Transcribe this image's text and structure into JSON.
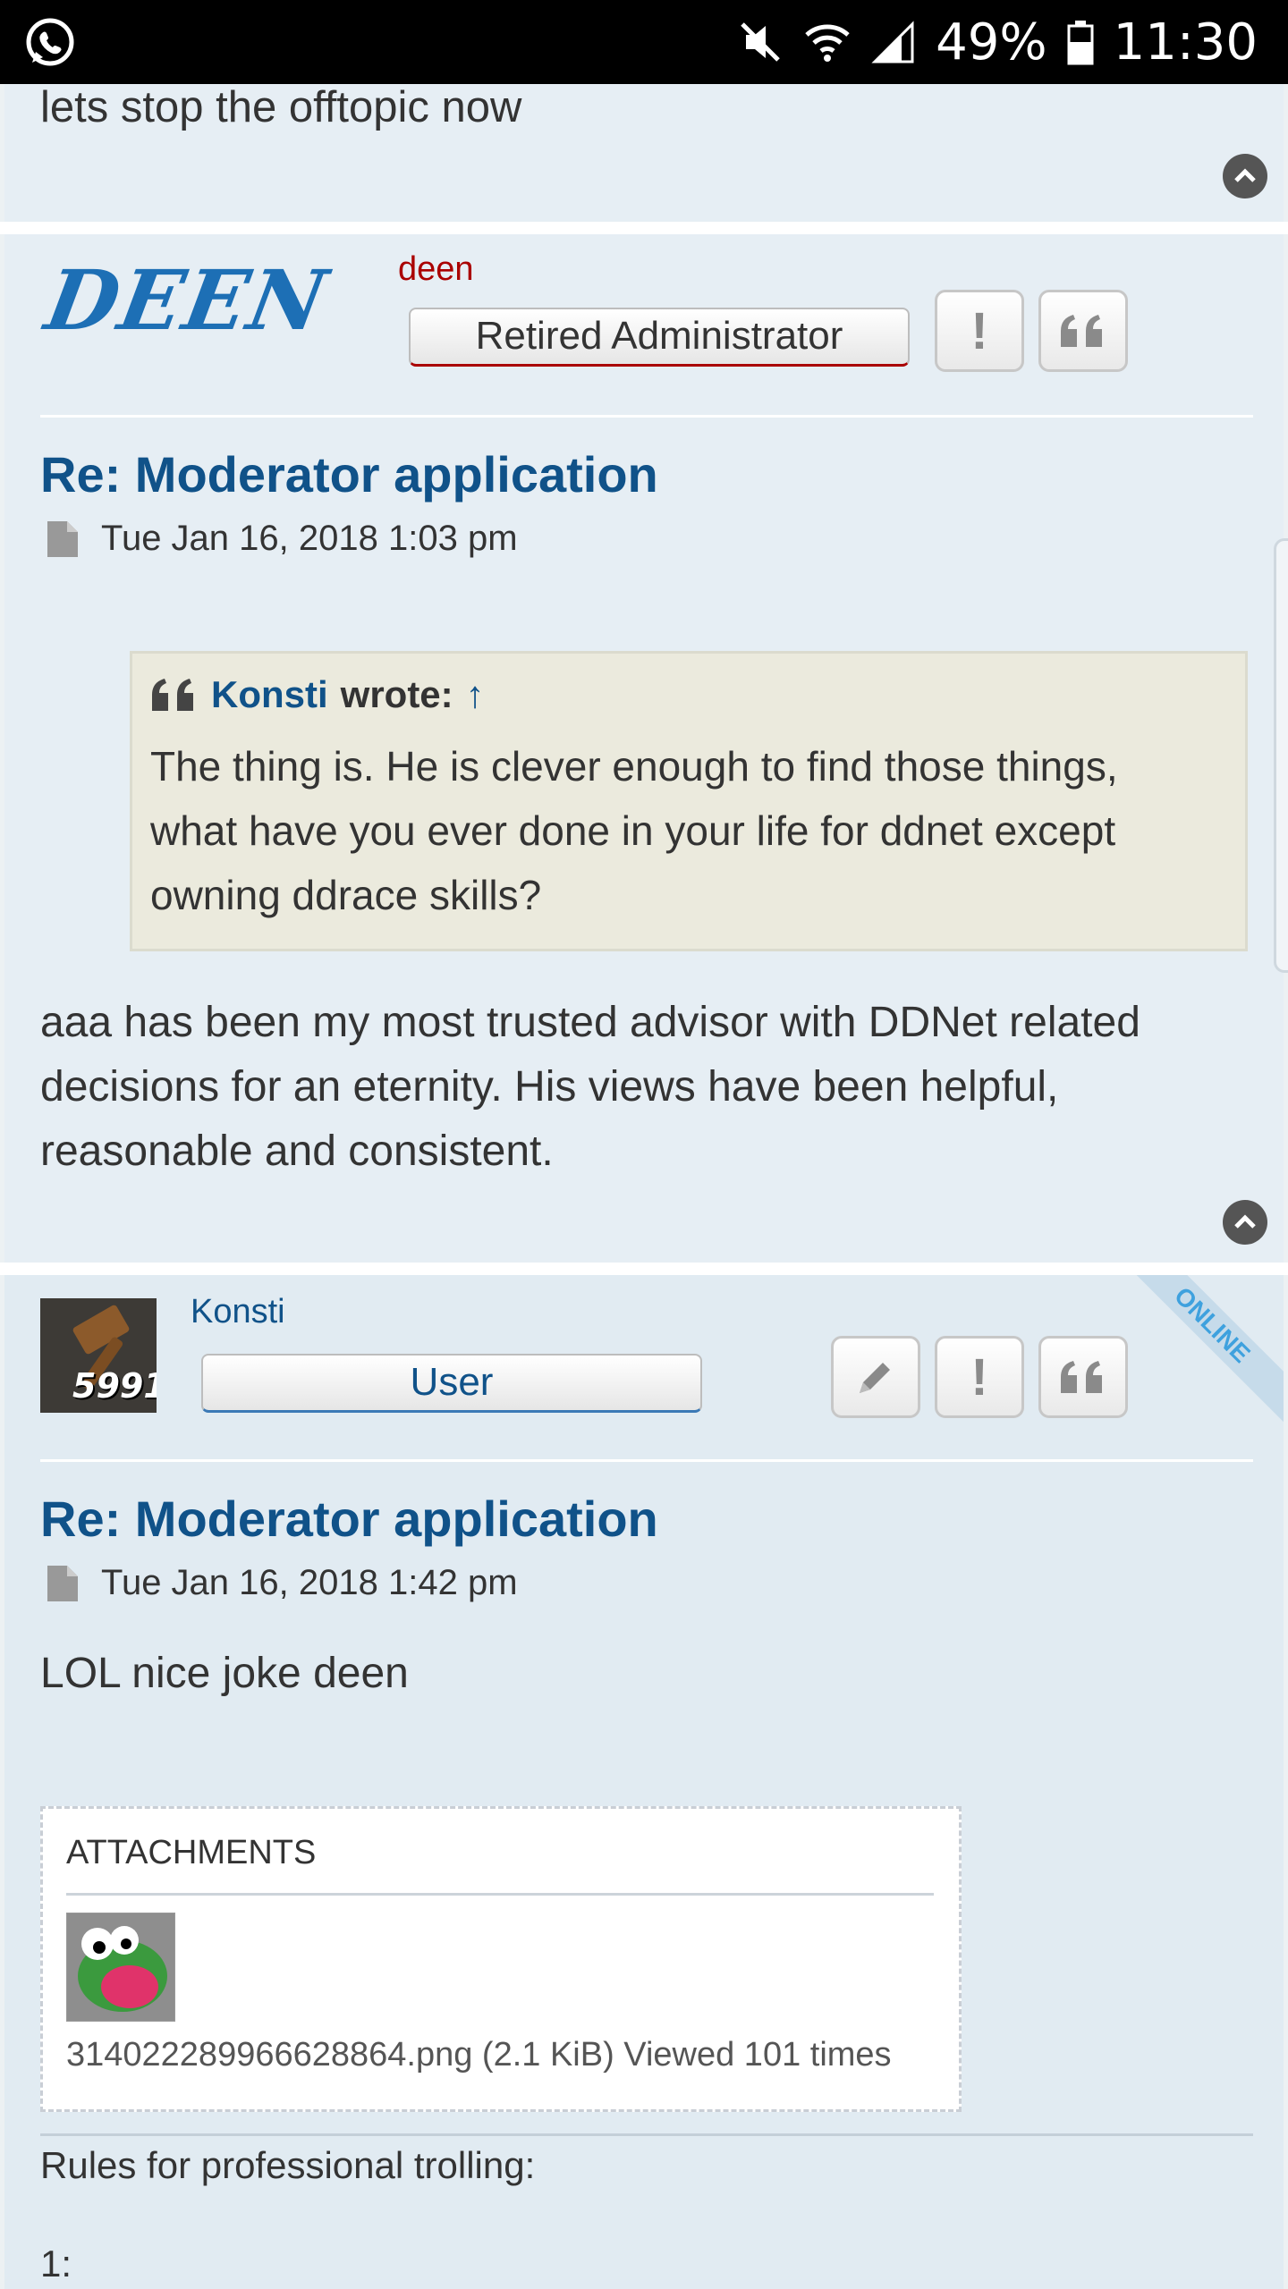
{
  "status_bar": {
    "battery": "49%",
    "time": "11:30"
  },
  "posts": [
    {
      "text": "lets stop the offtopic now"
    },
    {
      "logo_text": "DEEN",
      "author": "deen",
      "rank": "Retired Administrator",
      "title": "Re: Moderator application",
      "date": "Tue Jan 16, 2018 1:03 pm",
      "quote": {
        "author": "Konsti",
        "wrote": "wrote:",
        "arrow": "↑",
        "lines": [
          "The thing is. He is clever enough to find those things,",
          "what have you ever done in your life for ddnet except",
          "owning ddrace skills?"
        ]
      },
      "body_lines": [
        "aaa has been my most trusted advisor with DDNet related",
        "decisions for an eternity. His views have been helpful,",
        "reasonable and consistent."
      ]
    },
    {
      "avatar_text": "5991",
      "author": "Konsti",
      "rank": "User",
      "online_badge": "ONLINE",
      "title": "Re: Moderator application",
      "date": "Tue Jan 16, 2018 1:42 pm",
      "text": "LOL nice joke deen",
      "attachments": {
        "header": "ATTACHMENTS",
        "file_caption": "314022289966628864.png (2.1 KiB) Viewed 101 times"
      },
      "signature_lines": [
        "Rules for professional trolling:",
        "1:"
      ]
    }
  ],
  "colors": {
    "link": "#105289",
    "deen_name": "#aa0000",
    "konsti_name": "#105289",
    "online": "#3ea1de"
  }
}
